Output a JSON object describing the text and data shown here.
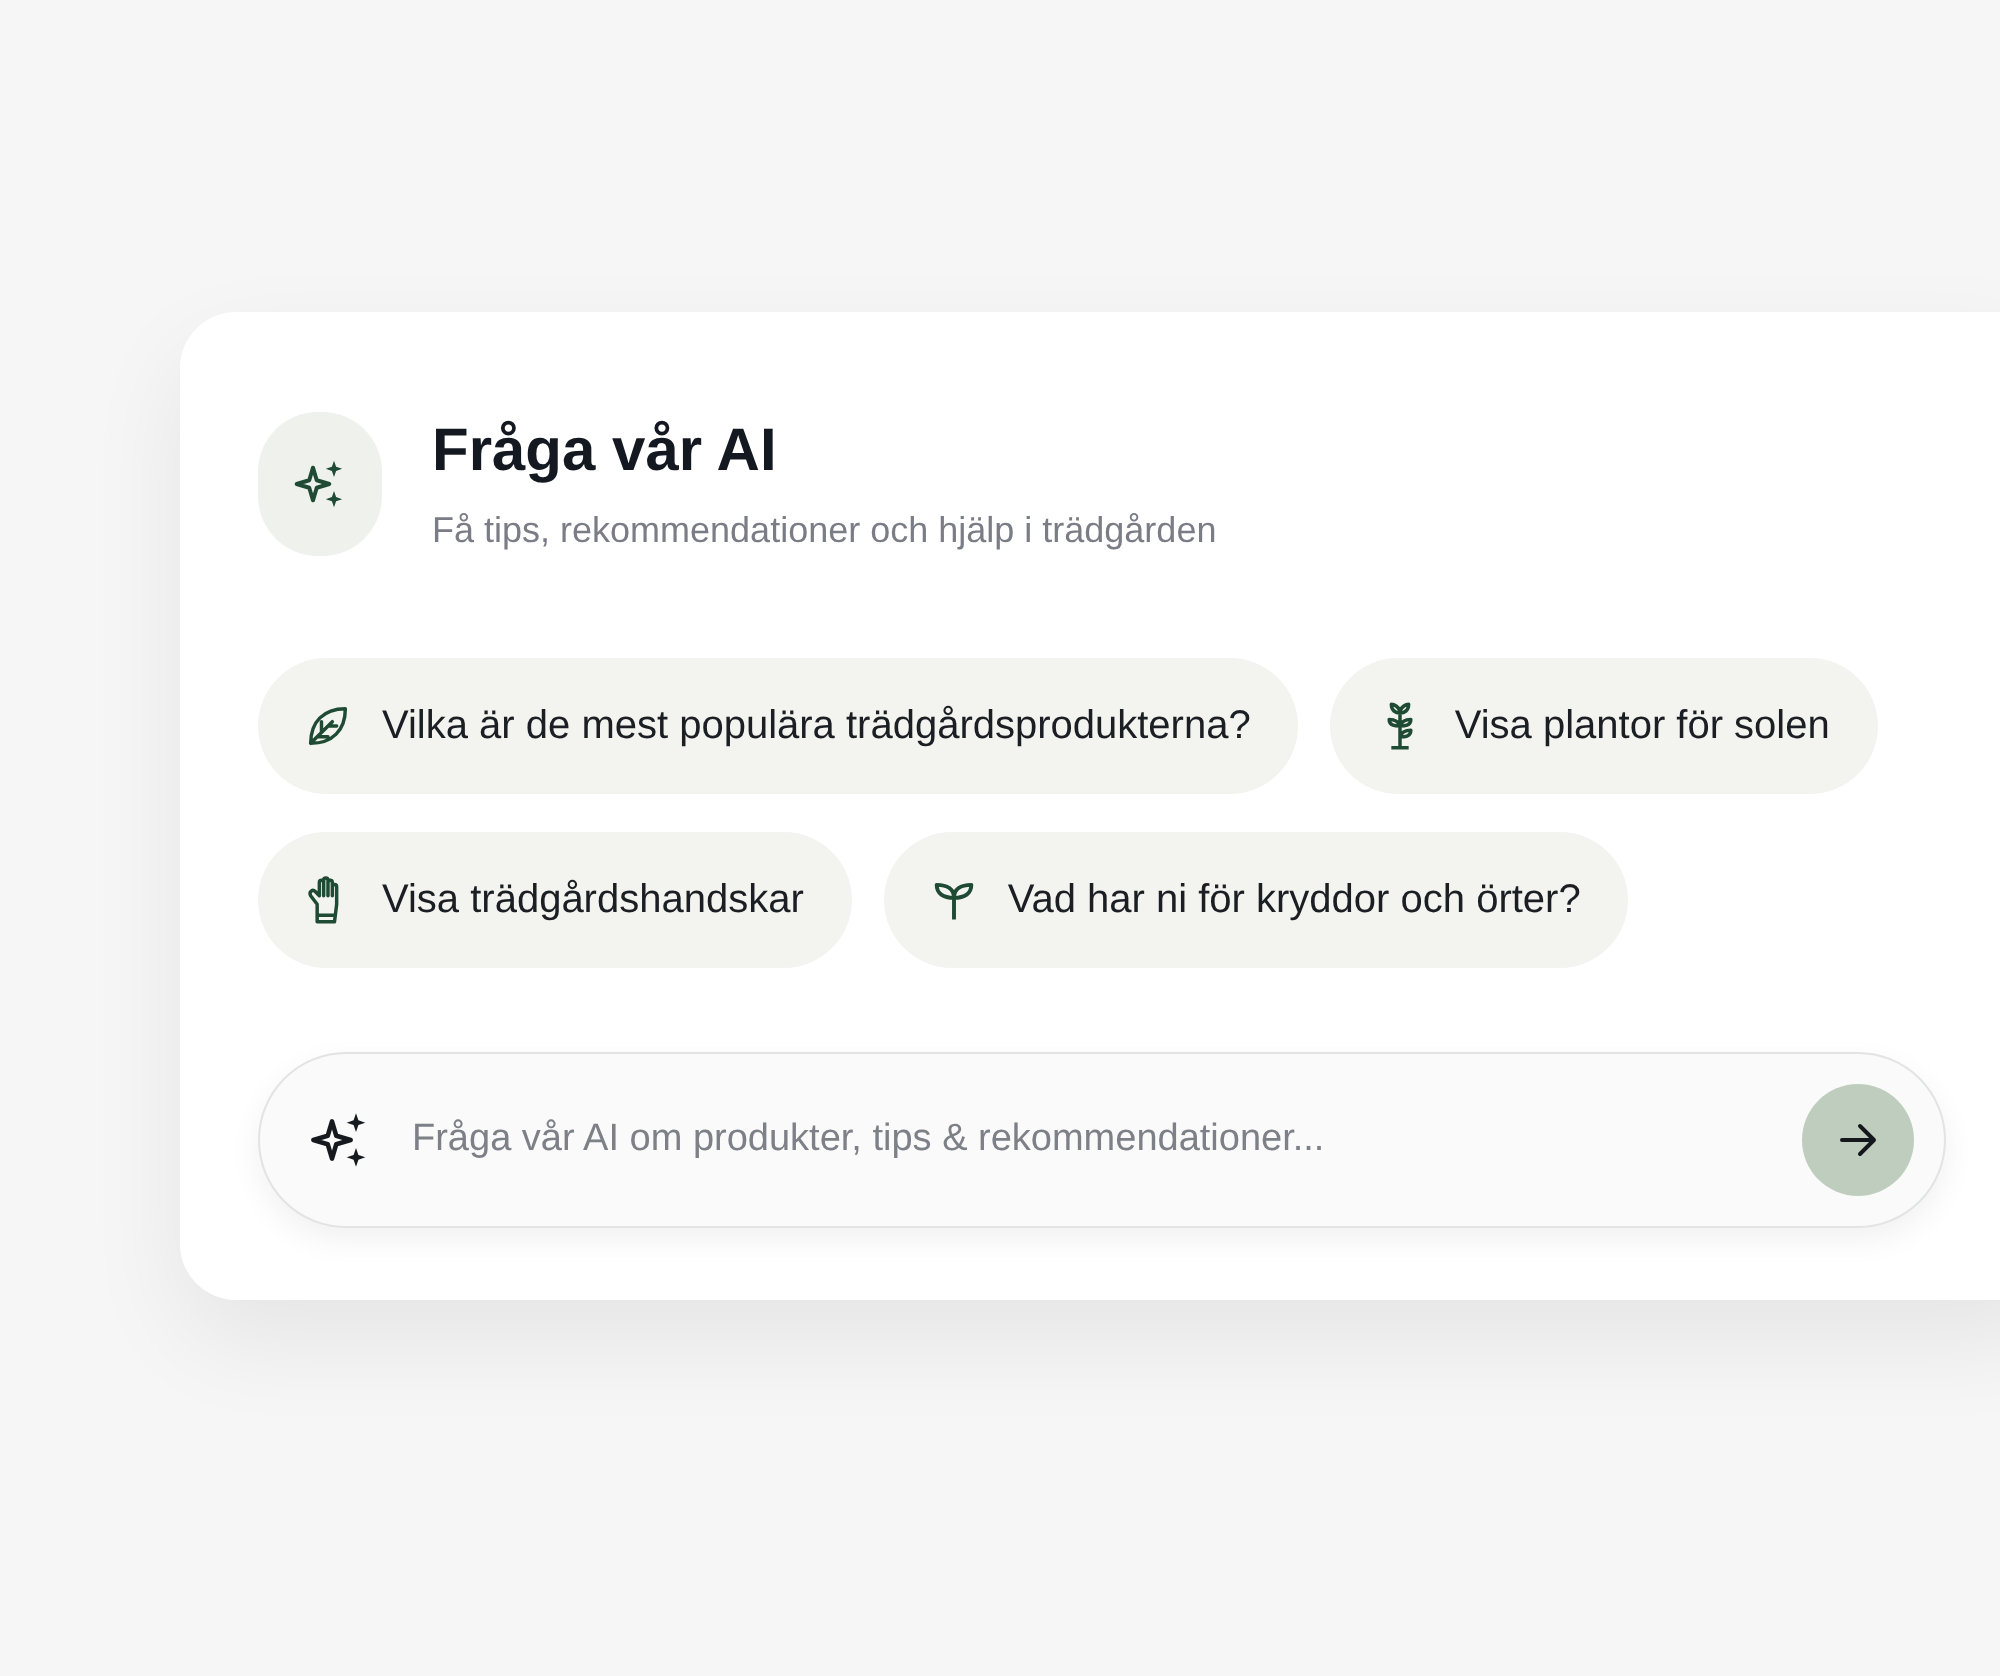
{
  "header": {
    "title": "Fråga vår AI",
    "subtitle": "Få tips, rekommendationer och hjälp i trädgården"
  },
  "suggestion_rows": [
    [
      {
        "label": "Vilka är de mest populära trädgårdsprodukterna?"
      },
      {
        "label": "Visa plantor för solen"
      }
    ],
    [
      {
        "label": "Visa trädgårdshandskar"
      },
      {
        "label": "Vad har ni för kryddor och örter?"
      }
    ]
  ],
  "input": {
    "placeholder": "Fråga vår AI om produkter, tips & rekommendationer..."
  }
}
